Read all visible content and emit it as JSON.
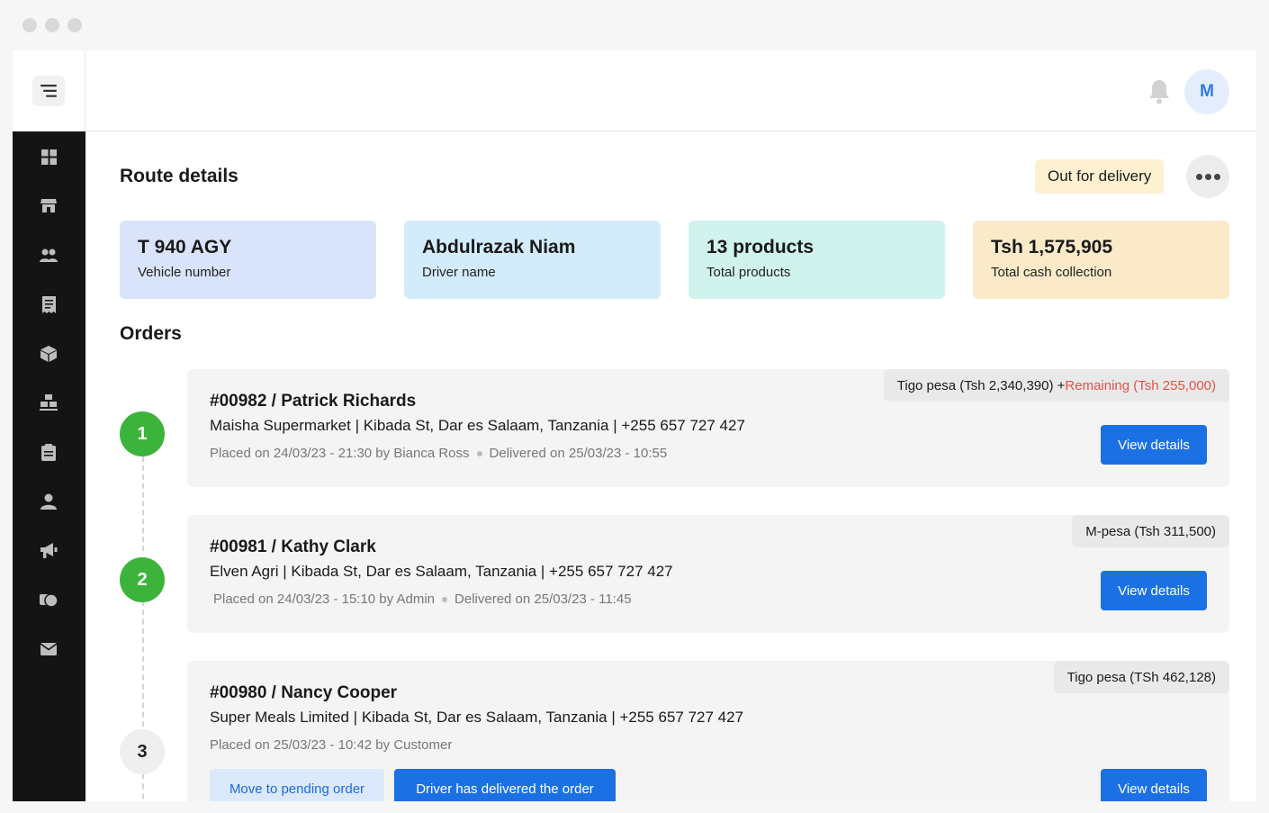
{
  "header": {
    "avatar_initial": "M"
  },
  "page": {
    "title": "Route details",
    "status": "Out for delivery"
  },
  "stats": [
    {
      "value": "T 940 AGY",
      "label": "Vehicle number",
      "color": "#d9e4fb"
    },
    {
      "value": "Abdulrazak Niam",
      "label": "Driver name",
      "color": "#d3ecfb"
    },
    {
      "value": "13 products",
      "label": "Total products",
      "color": "#d0f3ee"
    },
    {
      "value": "Tsh 1,575,905",
      "label": "Total cash collection",
      "color": "#fbeac8"
    }
  ],
  "orders_title": "Orders",
  "orders": [
    {
      "step": "1",
      "id_name": "#00982 / Patrick Richards",
      "address": "Maisha Supermarket | Kibada St, Dar es Salaam, Tanzania | +255 657 727 427",
      "placed": "Placed on 24/03/23 - 21:30 by Bianca Ross",
      "delivered": "Delivered on 25/03/23 - 10:55",
      "payment": "Tigo pesa (Tsh 2,340,390) + ",
      "remaining": "Remaining (Tsh 255,000)",
      "view_label": "View details"
    },
    {
      "step": "2",
      "id_name": "#00981 / Kathy Clark",
      "address": "Elven Agri | Kibada St, Dar es Salaam, Tanzania | +255 657 727 427",
      "placed": "Placed on 24/03/23 - 15:10 by Admin",
      "delivered": "Delivered on 25/03/23 - 11:45",
      "payment": "M-pesa (Tsh 311,500)",
      "view_label": "View details"
    },
    {
      "step": "3",
      "id_name": "#00980 / Nancy Cooper",
      "address": "Super Meals Limited | Kibada St, Dar es Salaam, Tanzania | +255 657 727 427",
      "placed": "Placed on 25/03/23 - 10:42 by Customer",
      "payment": "Tigo pesa (TSh 462,128)",
      "view_label": "View details",
      "pending_label": "Move to pending order",
      "delivered_btn_label": "Driver has delivered the order"
    }
  ],
  "sidebar": [
    "dashboard-icon",
    "store-icon",
    "users-icon",
    "receipt-icon",
    "box-icon",
    "warehouse-icon",
    "clipboard-icon",
    "driver-icon",
    "megaphone-icon",
    "finance-icon",
    "mail-icon"
  ]
}
